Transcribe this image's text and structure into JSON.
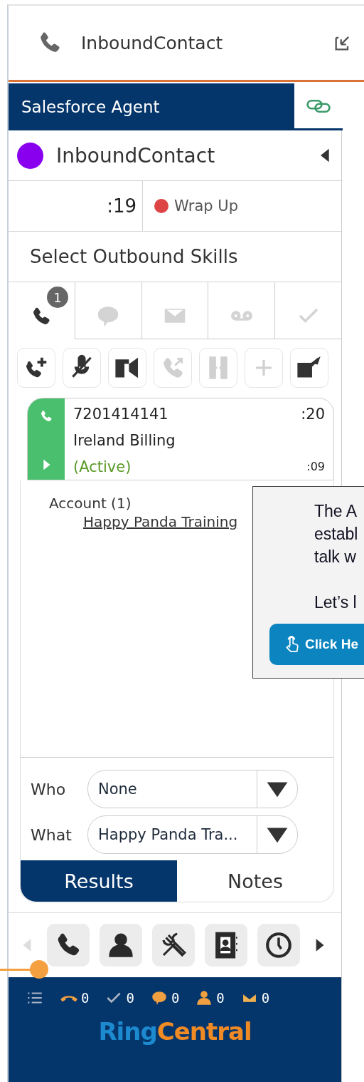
{
  "header": {
    "title": "InboundContact"
  },
  "agent_bar": {
    "title": "Salesforce Agent"
  },
  "contact": {
    "name": "InboundContact",
    "color": "#8800ee"
  },
  "status": {
    "timer": ":19",
    "label": "Wrap Up",
    "color": "#dd4444"
  },
  "skills": {
    "label": "Select Outbound Skills"
  },
  "channel_tabs": [
    {
      "kind": "phone",
      "selected": true,
      "badge": "1"
    },
    {
      "kind": "chat",
      "selected": false
    },
    {
      "kind": "email",
      "selected": false
    },
    {
      "kind": "voicemail",
      "selected": false
    },
    {
      "kind": "done",
      "selected": false
    }
  ],
  "call_actions": [
    {
      "kind": "add-call",
      "disabled": false
    },
    {
      "kind": "mute",
      "disabled": false
    },
    {
      "kind": "keypad",
      "disabled": false
    },
    {
      "kind": "transfer",
      "disabled": true
    },
    {
      "kind": "conference",
      "disabled": true
    },
    {
      "kind": "add",
      "disabled": true
    },
    {
      "kind": "external",
      "disabled": false
    }
  ],
  "call": {
    "number": "7201414141",
    "total_time": ":20",
    "queue": "Ireland Billing",
    "state": "(Active)",
    "state_time": ":09"
  },
  "related": {
    "heading": "Account (1)",
    "link": "Happy Panda Training"
  },
  "fields": [
    {
      "label": "Who",
      "value": "None"
    },
    {
      "label": "What",
      "value": "Happy Panda Tra..."
    }
  ],
  "result_tabs": [
    {
      "label": "Results",
      "selected": true
    },
    {
      "label": "Notes",
      "selected": false
    }
  ],
  "nav": [
    {
      "kind": "prev",
      "disabled": true
    },
    {
      "kind": "phone",
      "disabled": false
    },
    {
      "kind": "agent",
      "disabled": false
    },
    {
      "kind": "tools",
      "disabled": false
    },
    {
      "kind": "contacts",
      "disabled": false
    },
    {
      "kind": "history",
      "disabled": false
    },
    {
      "kind": "next",
      "disabled": false
    }
  ],
  "counters": [
    {
      "kind": "list"
    },
    {
      "kind": "hangup",
      "count": "0"
    },
    {
      "kind": "check",
      "count": "0"
    },
    {
      "kind": "chat",
      "count": "0"
    },
    {
      "kind": "person",
      "count": "0"
    },
    {
      "kind": "mail",
      "count": "0"
    }
  ],
  "logo": {
    "part1": "Ring",
    "part2": "Central"
  },
  "tooltip": {
    "lines": [
      "The A",
      "establ",
      "talk w"
    ],
    "second": "Let’s l",
    "button": "Click He"
  }
}
